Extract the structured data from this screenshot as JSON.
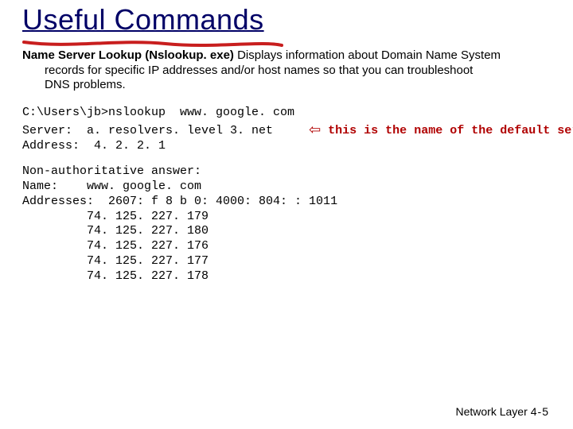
{
  "title": "Useful Commands",
  "desc": {
    "bold": "Name Server Lookup (Nslookup. exe)",
    "rest_line1": " Displays information about Domain Name System",
    "rest_line2": "records for specific IP addresses and/or host names so that you can troubleshoot",
    "rest_line3": "DNS problems."
  },
  "cmd": {
    "line1": "C:\\Users\\jb>nslookup  www. google. com",
    "line2_prefix": "Server:  a. resolvers. level 3. net     ",
    "line2_annotation": "this is the name of the default server",
    "line3": "Address:  4. 2. 2. 1"
  },
  "answer": {
    "l1": "Non-authoritative answer:",
    "l2": "Name:    www. google. com",
    "l3": "Addresses:  2607: f 8 b 0: 4000: 804: : 1011",
    "l4": "         74. 125. 227. 179",
    "l5": "         74. 125. 227. 180",
    "l6": "         74. 125. 227. 176",
    "l7": "         74. 125. 227. 177",
    "l8": "         74. 125. 227. 178"
  },
  "footer": {
    "section": "Network Layer",
    "page": "4-5"
  },
  "arrow_glyph": "⇦"
}
